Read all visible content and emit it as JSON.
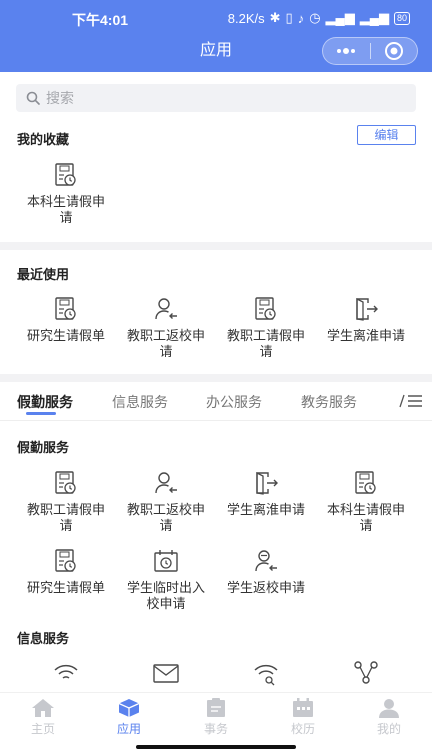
{
  "status_bar": {
    "time": "下午4:01",
    "speed": "8.2K/s",
    "battery": "80"
  },
  "header": {
    "title": "应用"
  },
  "search": {
    "placeholder": "搜索"
  },
  "favorites": {
    "title": "我的收藏",
    "edit_label": "编辑",
    "items": [
      {
        "label": "本科生请假申请",
        "icon": "leave-form-icon"
      }
    ]
  },
  "recent": {
    "title": "最近使用",
    "items": [
      {
        "label": "研究生请假单",
        "icon": "leave-form-icon"
      },
      {
        "label": "教职工返校申请",
        "icon": "user-return-icon"
      },
      {
        "label": "教职工请假申请",
        "icon": "leave-form-icon"
      },
      {
        "label": "学生离淮申请",
        "icon": "exit-door-icon"
      }
    ]
  },
  "tabs": {
    "items": [
      "假勤服务",
      "信息服务",
      "办公服务",
      "教务服务"
    ],
    "active_index": 0
  },
  "leave_services": {
    "title": "假勤服务",
    "items": [
      {
        "label": "教职工请假申请",
        "icon": "leave-form-icon"
      },
      {
        "label": "教职工返校申请",
        "icon": "user-return-icon"
      },
      {
        "label": "学生离淮申请",
        "icon": "exit-door-icon"
      },
      {
        "label": "本科生请假申请",
        "icon": "leave-form-icon"
      },
      {
        "label": "研究生请假单",
        "icon": "leave-form-icon"
      },
      {
        "label": "学生临时出入校申请",
        "icon": "calendar-clock-icon"
      },
      {
        "label": "学生返校申请",
        "icon": "user-return-icon"
      }
    ]
  },
  "info_services": {
    "title": "信息服务",
    "items": [
      {
        "icon": "wifi-icon"
      },
      {
        "icon": "mail-icon"
      },
      {
        "icon": "wifi-search-icon"
      },
      {
        "icon": "network-icon"
      }
    ]
  },
  "bottom_nav": {
    "items": [
      {
        "label": "主页",
        "icon": "home-icon"
      },
      {
        "label": "应用",
        "icon": "cube-icon"
      },
      {
        "label": "事务",
        "icon": "clipboard-icon"
      },
      {
        "label": "校历",
        "icon": "calendar-icon"
      },
      {
        "label": "我的",
        "icon": "person-icon"
      }
    ],
    "active_index": 1
  },
  "colors": {
    "primary": "#5a82ee",
    "icon_gray": "#4a4a4a",
    "tab_inactive": "#c6c8cd"
  }
}
